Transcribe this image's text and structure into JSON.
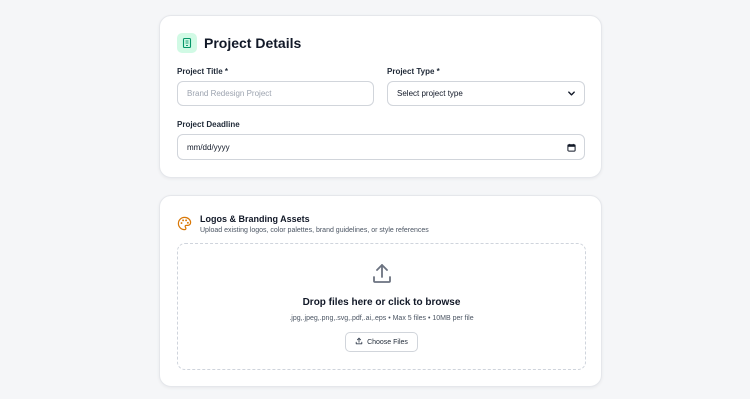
{
  "project_details": {
    "title": "Project Details",
    "icon": "building-icon",
    "accent_color": "#059669",
    "fields": {
      "project_title": {
        "label": "Project Title *",
        "placeholder": "Brand Redesign Project",
        "value": ""
      },
      "project_type": {
        "label": "Project Type *",
        "selected": "Select project type"
      },
      "project_deadline": {
        "label": "Project Deadline",
        "value": "mm/dd/yyyy"
      }
    }
  },
  "branding_assets": {
    "title": "Logos & Branding Assets",
    "description": "Upload existing logos, color palettes, brand guidelines, or style references",
    "icon": "palette-icon",
    "icon_color": "#d97706",
    "dropzone": {
      "title": "Drop files here or click to browse",
      "hint": ".jpg,.jpeg,.png,.svg,.pdf,.ai,.eps • Max 5 files • 10MB per file",
      "button_label": "Choose Files",
      "icon": "upload-icon"
    }
  }
}
